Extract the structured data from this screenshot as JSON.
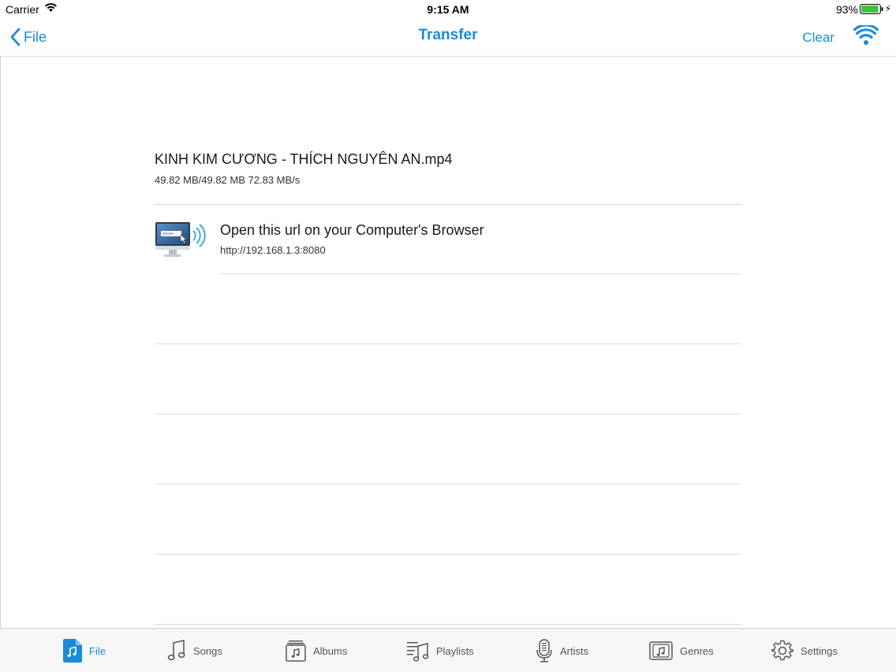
{
  "status": {
    "carrier": "Carrier",
    "time": "9:15 AM",
    "battery_pct": "93%",
    "battery_level": 0.93
  },
  "nav": {
    "back_label": "File",
    "title": "Transfer",
    "clear_label": "Clear"
  },
  "transfer": {
    "filename": "KINH KIM CƯƠNG - THÍCH NGUYÊN AN.mp4",
    "progress": "49.82 MB/49.82 MB  72.83 MB/s"
  },
  "url_row": {
    "title": "Open this url on your Computer's Browser",
    "url": "http://192.168.1.3:8080"
  },
  "tabs": [
    {
      "label": "File",
      "icon": "file-music-icon",
      "active": true
    },
    {
      "label": "Songs",
      "icon": "music-note-icon",
      "active": false
    },
    {
      "label": "Albums",
      "icon": "album-icon",
      "active": false
    },
    {
      "label": "Playlists",
      "icon": "playlist-icon",
      "active": false
    },
    {
      "label": "Artists",
      "icon": "microphone-icon",
      "active": false
    },
    {
      "label": "Genres",
      "icon": "genre-icon",
      "active": false
    },
    {
      "label": "Settings",
      "icon": "gear-icon",
      "active": false
    }
  ],
  "colors": {
    "accent": "#1c8ad8",
    "separator": "#dcdcdc",
    "tab_bar_bg": "#f7f7f7"
  }
}
